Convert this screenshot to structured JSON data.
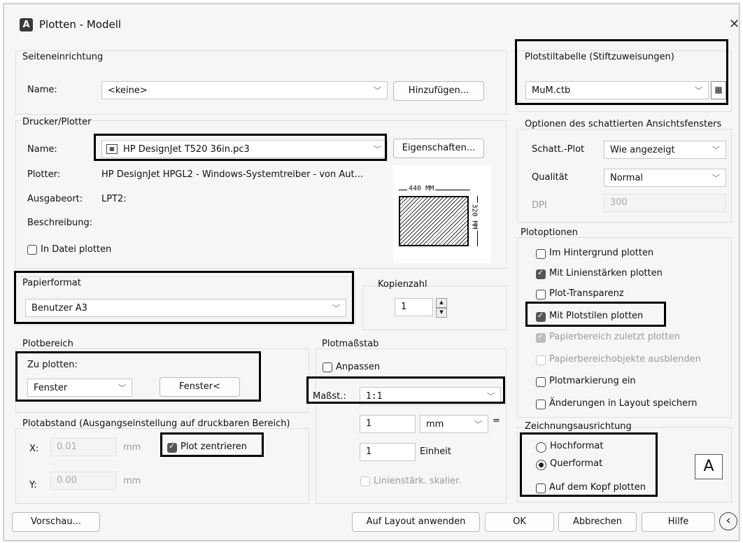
{
  "window": {
    "title": "Plotten - Modell",
    "icon": "autocad-app-icon",
    "close_glyph": "✕"
  },
  "seiteneinrichtung": {
    "group": "Seiteneinrichtung",
    "name_label": "Name:",
    "name_value": "<keine>",
    "add_button": "Hinzufügen..."
  },
  "drucker": {
    "group": "Drucker/Plotter",
    "name_label": "Name:",
    "name_value": "HP DesignJet T520 36in.pc3",
    "properties_button": "Eigenschaften...",
    "plotter_label": "Plotter:",
    "plotter_value": "HP DesignJet HPGL2 - Windows-Systemtreiber - von Aut...",
    "ausgabeort_label": "Ausgabeort:",
    "ausgabeort_value": "LPT2:",
    "beschreibung_label": "Beschreibung:",
    "to_file_label": "In Datei plotten",
    "to_file_checked": false,
    "preview_width": "440 MM",
    "preview_height": "320 MM"
  },
  "papierformat": {
    "group": "Papierformat",
    "value": "Benutzer A3"
  },
  "kopien": {
    "group": "Kopienzahl",
    "value": "1"
  },
  "plotbereich": {
    "group": "Plotbereich",
    "label": "Zu plotten:",
    "value": "Fenster",
    "window_button": "Fenster<"
  },
  "plotabstand": {
    "group": "Plotabstand (Ausgangseinstellung auf druckbaren Bereich)",
    "x_label": "X:",
    "x_value": "0.01",
    "x_unit": "mm",
    "y_label": "Y:",
    "y_value": "0.00",
    "y_unit": "mm",
    "center_label": "Plot zentrieren",
    "center_checked": true
  },
  "plotmassstab": {
    "group": "Plotmaßstab",
    "fit_label": "Anpassen",
    "fit_checked": false,
    "scale_label": "Maßst.:",
    "scale_value": "1:1",
    "value1": "1",
    "unit1": "mm",
    "equals": "=",
    "value2": "1",
    "unit2": "Einheit",
    "lineweight_label": "Linienstärk. skalier."
  },
  "plotstil": {
    "group": "Plotstiltabelle (Stiftzuweisungen)",
    "value": "MuM.ctb"
  },
  "schattiert": {
    "group": "Optionen des schattierten Ansichtsfensters",
    "shade_label": "Schatt.-Plot",
    "shade_value": "Wie angezeigt",
    "quality_label": "Qualität",
    "quality_value": "Normal",
    "dpi_label": "DPI",
    "dpi_value": "300"
  },
  "plotoptionen": {
    "group": "Plotoptionen",
    "items": [
      {
        "label": "Im Hintergrund plotten",
        "checked": false,
        "enabled": true
      },
      {
        "label": "Mit Linienstärken plotten",
        "checked": true,
        "enabled": true
      },
      {
        "label": "Plot-Transparenz",
        "checked": false,
        "enabled": true
      },
      {
        "label": "Mit Plotstilen plotten",
        "checked": true,
        "enabled": true
      },
      {
        "label": "Papierbereich zuletzt plotten",
        "checked": true,
        "enabled": false
      },
      {
        "label": "Papierbereichobjekte ausblenden",
        "checked": false,
        "enabled": false
      },
      {
        "label": "Plotmarkierung ein",
        "checked": false,
        "enabled": true
      },
      {
        "label": "Änderungen in Layout speichern",
        "checked": false,
        "enabled": true
      }
    ]
  },
  "ausrichtung": {
    "group": "Zeichnungsausrichtung",
    "portrait": "Hochformat",
    "landscape": "Querformat",
    "selected": "Querformat",
    "upside_down": "Auf dem Kopf plotten",
    "upside_down_checked": false,
    "icon_letter": "A"
  },
  "footer": {
    "preview": "Vorschau...",
    "apply": "Auf Layout anwenden",
    "ok": "OK",
    "cancel": "Abbrechen",
    "help": "Hilfe",
    "collapse_glyph": "‹"
  }
}
